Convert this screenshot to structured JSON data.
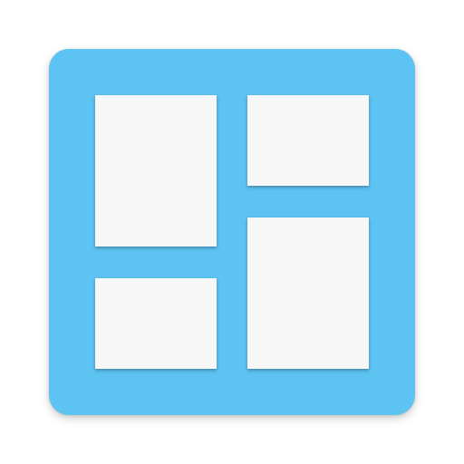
{
  "icon": {
    "name": "masonry-grid-app-icon",
    "colors": {
      "tile": "#5CC3F2",
      "card": "#F7F7F7"
    }
  }
}
